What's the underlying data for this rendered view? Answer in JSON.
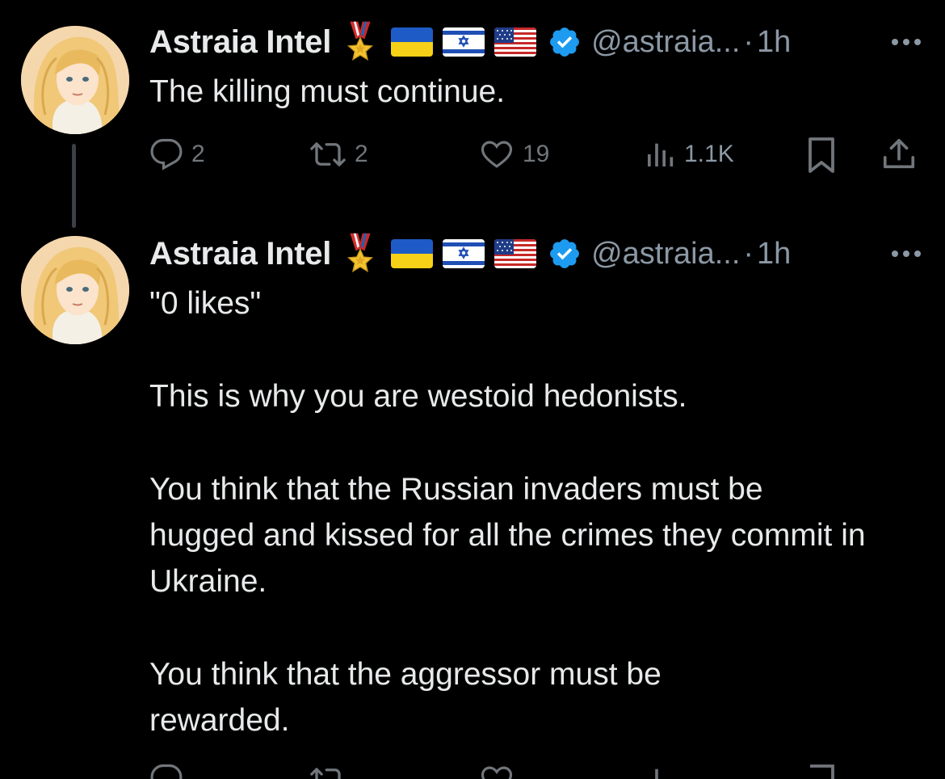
{
  "tweets": [
    {
      "name": "Astraia Intel",
      "handle": "@astraia...",
      "separator": "·",
      "time": "1h",
      "text": [
        "The killing must continue."
      ],
      "actions": {
        "replies": "2",
        "reposts": "2",
        "likes": "19",
        "views": "1.1K"
      }
    },
    {
      "name": "Astraia Intel",
      "handle": "@astraia...",
      "separator": "·",
      "time": "1h",
      "text": [
        "\"0 likes\"",
        "This is why you are westoid hedonists.",
        "You think that the Russian invaders must be hugged and kissed for all the crimes they commit in Ukraine.",
        "You think that the aggressor must be rewarded."
      ]
    }
  ],
  "icons": {
    "medal": "medal-icon",
    "flags": [
      "ukraine-flag-icon",
      "israel-flag-icon",
      "usa-flag-icon"
    ],
    "verified": "verified-badge-icon",
    "more": "more-options-icon",
    "reply": "reply-icon",
    "repost": "repost-icon",
    "like": "like-icon",
    "views": "views-icon",
    "bookmark": "bookmark-icon",
    "share": "share-icon"
  },
  "colors": {
    "background": "#000000",
    "text": "#e7e9ea",
    "muted": "#71767b",
    "verified": "#1d9bf0"
  }
}
